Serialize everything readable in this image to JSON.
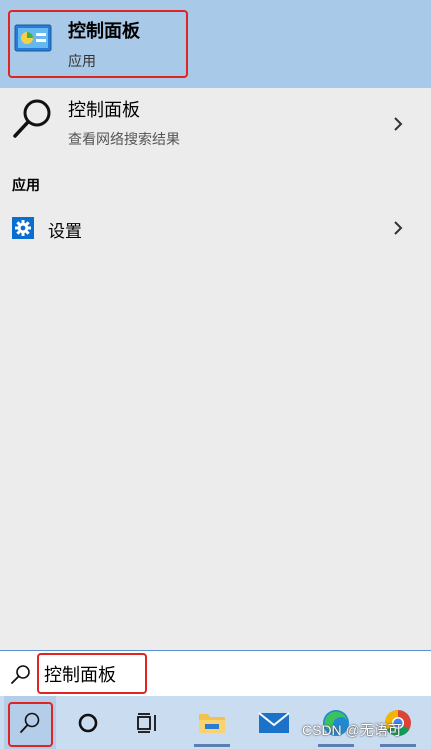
{
  "best_match": {
    "title": "控制面板",
    "subtitle": "应用"
  },
  "web_result": {
    "title": "控制面板",
    "subtitle": "查看网络搜索结果"
  },
  "section_apps": {
    "heading": "应用"
  },
  "apps": [
    {
      "label": "设置",
      "icon": "gear-icon"
    }
  ],
  "search": {
    "value": "控制面板"
  },
  "taskbar": {
    "items": [
      "search-icon",
      "cortana-icon",
      "task-view-icon",
      "file-explorer-icon",
      "mail-icon",
      "edge-icon",
      "chrome-icon"
    ]
  },
  "watermark": "CSDN @无语可",
  "colors": {
    "accent": "#a9c9e8",
    "highlight": "#e02424",
    "taskbar": "#c9dcf0",
    "settings_blue": "#0a6ed1"
  }
}
